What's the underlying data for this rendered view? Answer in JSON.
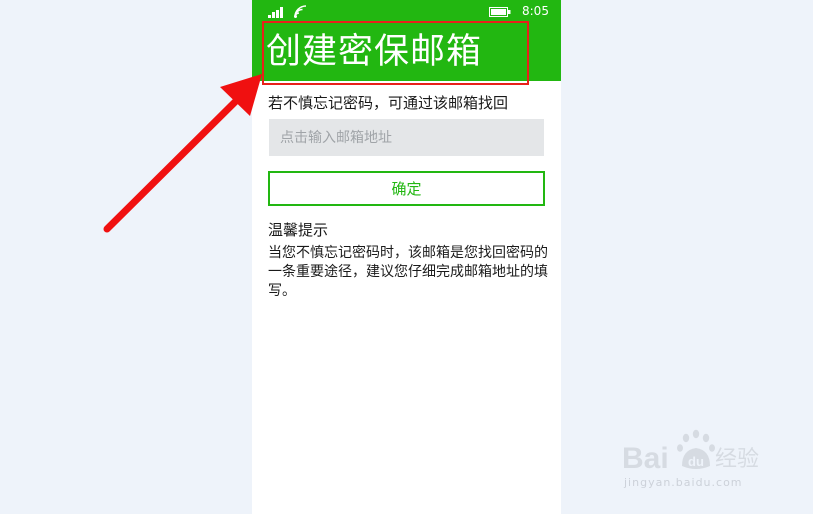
{
  "status_bar": {
    "time": "8:05",
    "icons": [
      "signal-icon",
      "wifi-icon",
      "battery-icon"
    ]
  },
  "header": {
    "title": "创建密保邮箱"
  },
  "form": {
    "hint": "若不慎忘记密码，可通过该邮箱找回",
    "email_placeholder": "点击输入邮箱地址",
    "email_value": "",
    "confirm_label": "确定"
  },
  "tips": {
    "title": "温馨提示",
    "body": "当您不慎忘记密码时，该邮箱是您找回密码的一条重要途径，建议您仔细完成邮箱地址的填写。"
  },
  "watermark": {
    "logo_text": "Baidu经验",
    "url": "jingyan.baidu.com"
  },
  "colors": {
    "header_green": "#22b711",
    "annotation_red": "#e8201a",
    "page_background": "#eef3fa",
    "input_background": "#e4e6e8"
  }
}
